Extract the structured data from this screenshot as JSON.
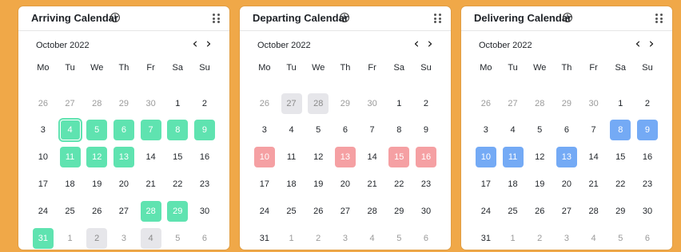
{
  "colors": {
    "page_background": "#f0a848",
    "arriving_highlight": "#5fe3b0",
    "departing_highlight": "#f5a0a3",
    "delivering_highlight": "#74aaf5",
    "disabled": "#e6e6ea"
  },
  "weekdays": [
    "Mo",
    "Tu",
    "We",
    "Th",
    "Fr",
    "Sa",
    "Su"
  ],
  "calendars": [
    {
      "title": "Arriving Calendar",
      "info_icon": "i",
      "month": "October 2022",
      "prev_icon": "‹",
      "next_icon": "›",
      "days": [
        {
          "label": "26",
          "state": "muted"
        },
        {
          "label": "27",
          "state": "muted"
        },
        {
          "label": "28",
          "state": "muted"
        },
        {
          "label": "29",
          "state": "muted"
        },
        {
          "label": "30",
          "state": "muted"
        },
        {
          "label": "1",
          "state": ""
        },
        {
          "label": "2",
          "state": ""
        },
        {
          "label": "3",
          "state": ""
        },
        {
          "label": "4",
          "state": "green selected"
        },
        {
          "label": "5",
          "state": "green"
        },
        {
          "label": "6",
          "state": "green"
        },
        {
          "label": "7",
          "state": "green"
        },
        {
          "label": "8",
          "state": "green"
        },
        {
          "label": "9",
          "state": "green"
        },
        {
          "label": "10",
          "state": ""
        },
        {
          "label": "11",
          "state": "green"
        },
        {
          "label": "12",
          "state": "green"
        },
        {
          "label": "13",
          "state": "green"
        },
        {
          "label": "14",
          "state": ""
        },
        {
          "label": "15",
          "state": ""
        },
        {
          "label": "16",
          "state": ""
        },
        {
          "label": "17",
          "state": ""
        },
        {
          "label": "18",
          "state": ""
        },
        {
          "label": "19",
          "state": ""
        },
        {
          "label": "20",
          "state": ""
        },
        {
          "label": "21",
          "state": ""
        },
        {
          "label": "22",
          "state": ""
        },
        {
          "label": "23",
          "state": ""
        },
        {
          "label": "24",
          "state": ""
        },
        {
          "label": "25",
          "state": ""
        },
        {
          "label": "26",
          "state": ""
        },
        {
          "label": "27",
          "state": ""
        },
        {
          "label": "28",
          "state": "green"
        },
        {
          "label": "29",
          "state": "green"
        },
        {
          "label": "30",
          "state": ""
        },
        {
          "label": "31",
          "state": "green"
        },
        {
          "label": "1",
          "state": "muted"
        },
        {
          "label": "2",
          "state": "gray"
        },
        {
          "label": "3",
          "state": "muted"
        },
        {
          "label": "4",
          "state": "gray"
        },
        {
          "label": "5",
          "state": "muted"
        },
        {
          "label": "6",
          "state": "muted"
        }
      ]
    },
    {
      "title": "Departing Calendar",
      "info_icon": "i",
      "month": "October 2022",
      "prev_icon": "‹",
      "next_icon": "›",
      "days": [
        {
          "label": "26",
          "state": "muted"
        },
        {
          "label": "27",
          "state": "gray"
        },
        {
          "label": "28",
          "state": "gray"
        },
        {
          "label": "29",
          "state": "muted"
        },
        {
          "label": "30",
          "state": "muted"
        },
        {
          "label": "1",
          "state": ""
        },
        {
          "label": "2",
          "state": ""
        },
        {
          "label": "3",
          "state": ""
        },
        {
          "label": "4",
          "state": ""
        },
        {
          "label": "5",
          "state": ""
        },
        {
          "label": "6",
          "state": ""
        },
        {
          "label": "7",
          "state": ""
        },
        {
          "label": "8",
          "state": ""
        },
        {
          "label": "9",
          "state": ""
        },
        {
          "label": "10",
          "state": "red"
        },
        {
          "label": "11",
          "state": ""
        },
        {
          "label": "12",
          "state": ""
        },
        {
          "label": "13",
          "state": "red"
        },
        {
          "label": "14",
          "state": ""
        },
        {
          "label": "15",
          "state": "red"
        },
        {
          "label": "16",
          "state": "red"
        },
        {
          "label": "17",
          "state": ""
        },
        {
          "label": "18",
          "state": ""
        },
        {
          "label": "19",
          "state": ""
        },
        {
          "label": "20",
          "state": ""
        },
        {
          "label": "21",
          "state": ""
        },
        {
          "label": "22",
          "state": ""
        },
        {
          "label": "23",
          "state": ""
        },
        {
          "label": "24",
          "state": ""
        },
        {
          "label": "25",
          "state": ""
        },
        {
          "label": "26",
          "state": ""
        },
        {
          "label": "27",
          "state": ""
        },
        {
          "label": "28",
          "state": ""
        },
        {
          "label": "29",
          "state": ""
        },
        {
          "label": "30",
          "state": ""
        },
        {
          "label": "31",
          "state": ""
        },
        {
          "label": "1",
          "state": "muted"
        },
        {
          "label": "2",
          "state": "muted"
        },
        {
          "label": "3",
          "state": "muted"
        },
        {
          "label": "4",
          "state": "muted"
        },
        {
          "label": "5",
          "state": "muted"
        },
        {
          "label": "6",
          "state": "muted"
        }
      ]
    },
    {
      "title": "Delivering Calendar",
      "info_icon": "i",
      "month": "October 2022",
      "prev_icon": "‹",
      "next_icon": "›",
      "days": [
        {
          "label": "26",
          "state": "muted"
        },
        {
          "label": "27",
          "state": "muted"
        },
        {
          "label": "28",
          "state": "muted"
        },
        {
          "label": "29",
          "state": "muted"
        },
        {
          "label": "30",
          "state": "muted"
        },
        {
          "label": "1",
          "state": ""
        },
        {
          "label": "2",
          "state": ""
        },
        {
          "label": "3",
          "state": ""
        },
        {
          "label": "4",
          "state": ""
        },
        {
          "label": "5",
          "state": ""
        },
        {
          "label": "6",
          "state": ""
        },
        {
          "label": "7",
          "state": ""
        },
        {
          "label": "8",
          "state": "blue"
        },
        {
          "label": "9",
          "state": "blue"
        },
        {
          "label": "10",
          "state": "blue"
        },
        {
          "label": "11",
          "state": "blue"
        },
        {
          "label": "12",
          "state": ""
        },
        {
          "label": "13",
          "state": "blue"
        },
        {
          "label": "14",
          "state": ""
        },
        {
          "label": "15",
          "state": ""
        },
        {
          "label": "16",
          "state": ""
        },
        {
          "label": "17",
          "state": ""
        },
        {
          "label": "18",
          "state": ""
        },
        {
          "label": "19",
          "state": ""
        },
        {
          "label": "20",
          "state": ""
        },
        {
          "label": "21",
          "state": ""
        },
        {
          "label": "22",
          "state": ""
        },
        {
          "label": "23",
          "state": ""
        },
        {
          "label": "24",
          "state": ""
        },
        {
          "label": "25",
          "state": ""
        },
        {
          "label": "26",
          "state": ""
        },
        {
          "label": "27",
          "state": ""
        },
        {
          "label": "28",
          "state": ""
        },
        {
          "label": "29",
          "state": ""
        },
        {
          "label": "30",
          "state": ""
        },
        {
          "label": "31",
          "state": ""
        },
        {
          "label": "1",
          "state": "muted"
        },
        {
          "label": "2",
          "state": "muted"
        },
        {
          "label": "3",
          "state": "muted"
        },
        {
          "label": "4",
          "state": "muted"
        },
        {
          "label": "5",
          "state": "muted"
        },
        {
          "label": "6",
          "state": "muted"
        }
      ]
    }
  ]
}
